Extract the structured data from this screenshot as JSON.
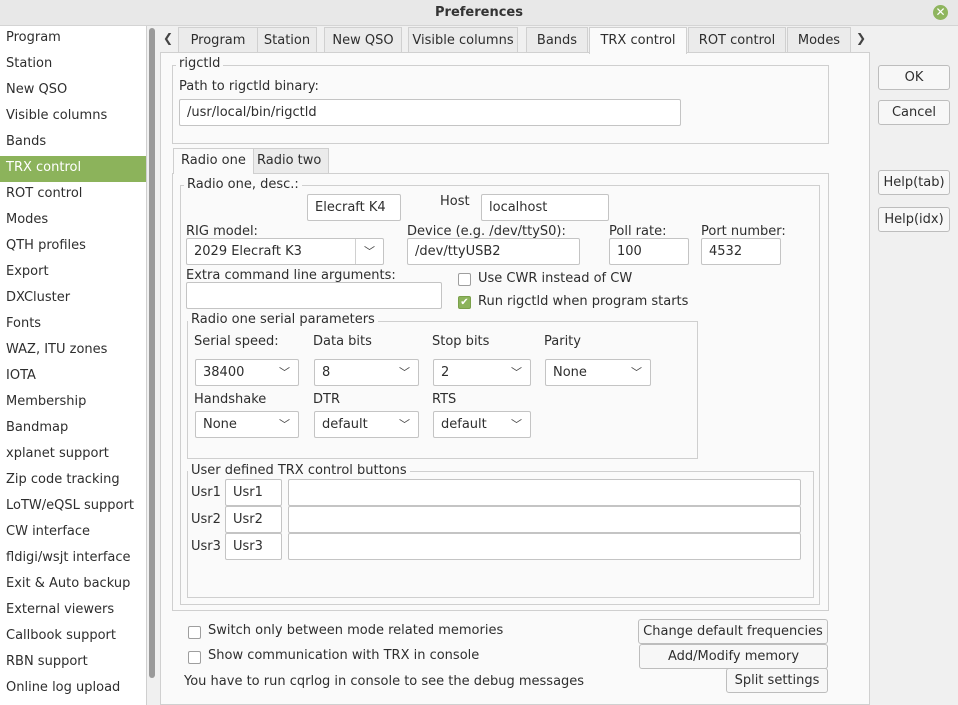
{
  "window": {
    "title": "Preferences"
  },
  "sidebar": {
    "items": [
      {
        "label": "Program"
      },
      {
        "label": "Station"
      },
      {
        "label": "New QSO"
      },
      {
        "label": "Visible columns"
      },
      {
        "label": "Bands"
      },
      {
        "label": "TRX control"
      },
      {
        "label": "ROT control"
      },
      {
        "label": "Modes"
      },
      {
        "label": "QTH profiles"
      },
      {
        "label": "Export"
      },
      {
        "label": "DXCluster"
      },
      {
        "label": "Fonts"
      },
      {
        "label": "WAZ, ITU zones"
      },
      {
        "label": "IOTA"
      },
      {
        "label": "Membership"
      },
      {
        "label": "Bandmap"
      },
      {
        "label": "xplanet support"
      },
      {
        "label": "Zip code tracking"
      },
      {
        "label": "LoTW/eQSL support"
      },
      {
        "label": "CW interface"
      },
      {
        "label": "fldigi/wsjt interface"
      },
      {
        "label": "Exit & Auto backup"
      },
      {
        "label": "External viewers"
      },
      {
        "label": "Callbook support"
      },
      {
        "label": "RBN support"
      },
      {
        "label": "Online log upload"
      }
    ],
    "selected_index": 5
  },
  "tabs": [
    {
      "label": "Program"
    },
    {
      "label": "Station"
    },
    {
      "label": "New QSO"
    },
    {
      "label": "Visible columns"
    },
    {
      "label": "Bands"
    },
    {
      "label": "TRX control"
    },
    {
      "label": "ROT control"
    },
    {
      "label": "Modes"
    }
  ],
  "rigctld": {
    "group_title": "rigctld",
    "path_label": "Path to rigctld binary:",
    "path_value": "/usr/local/bin/rigctld"
  },
  "radio_tabs": [
    {
      "label": "Radio one"
    },
    {
      "label": "Radio two"
    }
  ],
  "radio": {
    "group_title": "Radio one, desc.:",
    "desc_value": "Elecraft K4",
    "host_label": "Host",
    "host_value": "localhost",
    "rig_model_label": "RIG model:",
    "rig_model_value": "2029 Elecraft K3",
    "device_label": "Device (e.g. /dev/ttyS0):",
    "device_value": "/dev/ttyUSB2",
    "poll_label": "Poll rate:",
    "poll_value": "100",
    "port_label": "Port number:",
    "port_value": "4532",
    "extra_args_label": "Extra command line arguments:",
    "extra_args_value": "",
    "use_cwr_label": "Use CWR instead of CW",
    "use_cwr_checked": false,
    "run_rigctld_label": "Run rigctld when program starts",
    "run_rigctld_checked": true
  },
  "serial": {
    "group_title": "Radio one serial parameters",
    "speed_label": "Serial speed:",
    "speed_value": "38400",
    "databits_label": "Data bits",
    "databits_value": "8",
    "stopbits_label": "Stop bits",
    "stopbits_value": "2",
    "parity_label": "Parity",
    "parity_value": "None",
    "handshake_label": "Handshake",
    "handshake_value": "None",
    "dtr_label": "DTR",
    "dtr_value": "default",
    "rts_label": "RTS",
    "rts_value": "default"
  },
  "user_buttons": {
    "group_title": "User defined TRX control buttons",
    "rows": [
      {
        "label": "Usr1",
        "name": "Usr1",
        "command": ""
      },
      {
        "label": "Usr2",
        "name": "Usr2",
        "command": ""
      },
      {
        "label": "Usr3",
        "name": "Usr3",
        "command": ""
      }
    ]
  },
  "bottom": {
    "switch_memories_label": "Switch only between mode related memories",
    "show_comm_label": "Show communication with TRX in console",
    "debug_note": "You have to run cqrlog in console to see the debug messages",
    "change_freq_button": "Change default frequencies",
    "add_memory_button": "Add/Modify memory",
    "split_button": "Split settings"
  },
  "dialog_buttons": {
    "ok": "OK",
    "cancel": "Cancel",
    "help_tab": "Help(tab)",
    "help_idx": "Help(idx)"
  },
  "colors": {
    "accent": "#8cb35b"
  }
}
